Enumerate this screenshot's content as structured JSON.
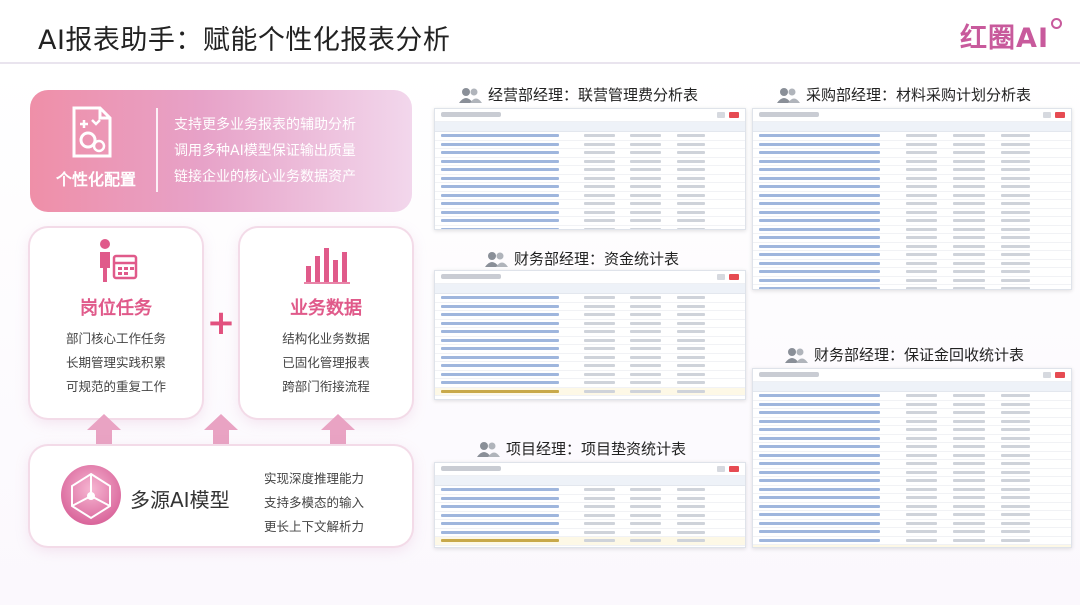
{
  "header": {
    "title": "AI报表助手：赋能个性化报表分析",
    "logo_text": "红圈AI"
  },
  "config_card": {
    "label": "个性化配置",
    "icon": "document-gears-icon",
    "lines": [
      "支持更多业务报表的辅助分析",
      "调用多种AI模型保证输出质量",
      "链接企业的核心业务数据资产"
    ]
  },
  "task_card": {
    "icon": "person-calendar-icon",
    "title": "岗位任务",
    "lines": [
      "部门核心工作任务",
      "长期管理实践积累",
      "可规范的重复工作"
    ]
  },
  "plus_sign": "+",
  "data_card": {
    "icon": "bar-chart-icon",
    "title": "业务数据",
    "lines": [
      "结构化业务数据",
      "已固化管理报表",
      "跨部门衔接流程"
    ]
  },
  "ai_card": {
    "icon": "ai-network-icon",
    "label": "多源AI模型",
    "lines": [
      "实现深度推理能力",
      "支持多模态的输入",
      "更长上下文解析力"
    ]
  },
  "reports": [
    {
      "title": "经营部经理：联营管理费分析表"
    },
    {
      "title": "采购部经理：材料采购计划分析表"
    },
    {
      "title": "财务部经理：资金统计表"
    },
    {
      "title": "财务部经理：保证金回收统计表"
    },
    {
      "title": "项目经理：项目垫资统计表"
    }
  ],
  "colors": {
    "accent": "#e05a8a",
    "card_gradient_start": "#ef8fa8",
    "card_gradient_end": "#f2d7ec",
    "arrow": "#e9a3c3"
  }
}
